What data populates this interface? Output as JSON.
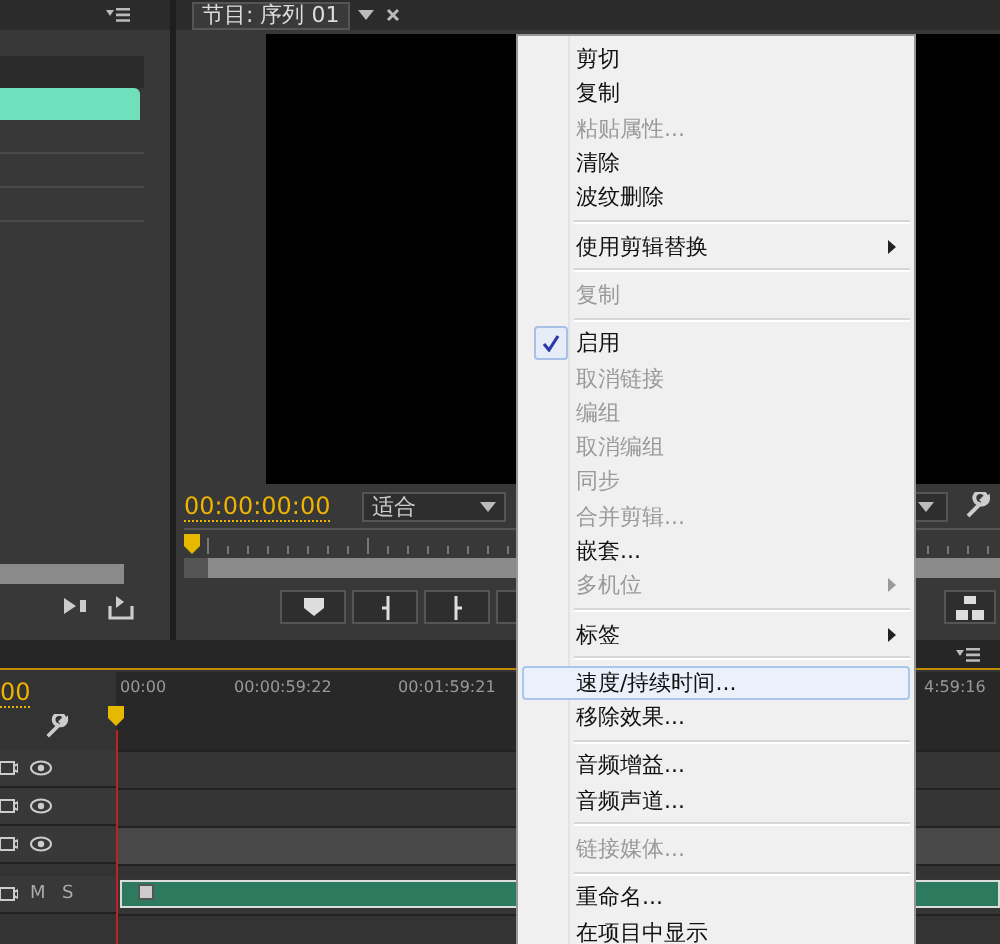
{
  "source_panel": {
    "kind": "panel"
  },
  "program_monitor": {
    "tab": {
      "label": "节目: 序列 01"
    },
    "timecode": "00:00:00:00",
    "zoom_dropdown": "适合"
  },
  "timeline": {
    "timecode": "00",
    "ruler_labels": [
      "00:00",
      "00:00:59:22",
      "00:01:59:21",
      "4:59:16"
    ],
    "tracks": [
      {
        "kind": "video",
        "targeted": false
      },
      {
        "kind": "video",
        "targeted": false
      },
      {
        "kind": "video",
        "targeted": true
      },
      {
        "kind": "audio",
        "targeted": false,
        "buttons": [
          "M",
          "S"
        ]
      }
    ]
  },
  "context_menu": {
    "items": [
      {
        "kind": "item",
        "label": "剪切",
        "disabled": false,
        "checked": false,
        "submenu": false,
        "selected": false
      },
      {
        "kind": "item",
        "label": "复制",
        "disabled": false,
        "checked": false,
        "submenu": false,
        "selected": false
      },
      {
        "kind": "item",
        "label": "粘贴属性...",
        "disabled": true,
        "checked": false,
        "submenu": false,
        "selected": false
      },
      {
        "kind": "item",
        "label": "清除",
        "disabled": false,
        "checked": false,
        "submenu": false,
        "selected": false
      },
      {
        "kind": "item",
        "label": "波纹删除",
        "disabled": false,
        "checked": false,
        "submenu": false,
        "selected": false
      },
      {
        "kind": "separator"
      },
      {
        "kind": "item",
        "label": "使用剪辑替换",
        "disabled": false,
        "checked": false,
        "submenu": true,
        "selected": false
      },
      {
        "kind": "separator"
      },
      {
        "kind": "item",
        "label": "复制",
        "disabled": true,
        "checked": false,
        "submenu": false,
        "selected": false
      },
      {
        "kind": "separator"
      },
      {
        "kind": "item",
        "label": "启用",
        "disabled": false,
        "checked": true,
        "submenu": false,
        "selected": false
      },
      {
        "kind": "item",
        "label": "取消链接",
        "disabled": true,
        "checked": false,
        "submenu": false,
        "selected": false
      },
      {
        "kind": "item",
        "label": "编组",
        "disabled": true,
        "checked": false,
        "submenu": false,
        "selected": false
      },
      {
        "kind": "item",
        "label": "取消编组",
        "disabled": true,
        "checked": false,
        "submenu": false,
        "selected": false
      },
      {
        "kind": "item",
        "label": "同步",
        "disabled": true,
        "checked": false,
        "submenu": false,
        "selected": false
      },
      {
        "kind": "item",
        "label": "合并剪辑...",
        "disabled": true,
        "checked": false,
        "submenu": false,
        "selected": false
      },
      {
        "kind": "item",
        "label": "嵌套...",
        "disabled": false,
        "checked": false,
        "submenu": false,
        "selected": false
      },
      {
        "kind": "item",
        "label": "多机位",
        "disabled": true,
        "checked": false,
        "submenu": true,
        "selected": false
      },
      {
        "kind": "separator"
      },
      {
        "kind": "item",
        "label": "标签",
        "disabled": false,
        "checked": false,
        "submenu": true,
        "selected": false
      },
      {
        "kind": "separator"
      },
      {
        "kind": "item",
        "label": "速度/持续时间...",
        "disabled": false,
        "checked": false,
        "submenu": false,
        "selected": true
      },
      {
        "kind": "item",
        "label": "移除效果...",
        "disabled": false,
        "checked": false,
        "submenu": false,
        "selected": false
      },
      {
        "kind": "separator"
      },
      {
        "kind": "item",
        "label": "音频增益...",
        "disabled": false,
        "checked": false,
        "submenu": false,
        "selected": false
      },
      {
        "kind": "item",
        "label": "音频声道...",
        "disabled": false,
        "checked": false,
        "submenu": false,
        "selected": false
      },
      {
        "kind": "separator"
      },
      {
        "kind": "item",
        "label": "链接媒体...",
        "disabled": true,
        "checked": false,
        "submenu": false,
        "selected": false
      },
      {
        "kind": "separator"
      },
      {
        "kind": "item",
        "label": "重命名...",
        "disabled": false,
        "checked": false,
        "submenu": false,
        "selected": false
      },
      {
        "kind": "item",
        "label": "在项目中显示",
        "disabled": false,
        "checked": false,
        "submenu": false,
        "selected": false
      }
    ]
  }
}
